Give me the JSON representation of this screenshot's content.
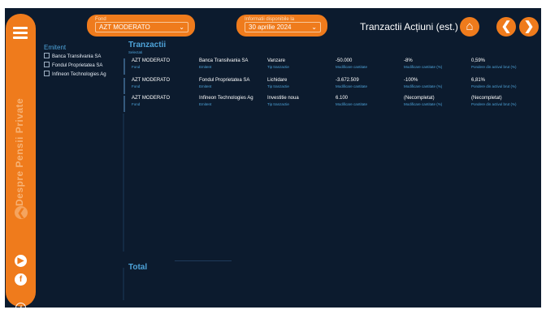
{
  "sidebar": {
    "vertical_text": "Despre Pensii Private"
  },
  "fund_select": {
    "label": "Fond",
    "value": "AZT MODERATO"
  },
  "date_select": {
    "label": "Informatii disponibile la",
    "value": "30 aprilie 2024"
  },
  "header": {
    "title": "Tranzactii Acțiuni (est.)"
  },
  "filter": {
    "title": "Emitent",
    "items": [
      "Banca Transilvania SA",
      "Fondul Proprietatea SA",
      "Infineon Technologies Ag"
    ]
  },
  "main": {
    "title": "Tranzactii",
    "subtitle": "Selectati",
    "total_label": "Total",
    "rows": [
      {
        "fund": "AZT MODERATO",
        "fund_cap": "Fond",
        "issuer": "Banca Transilvania SA",
        "issuer_cap": "Emitent",
        "type": "Vanzare",
        "type_cap": "Tip tranzactie",
        "qty": "-50.000",
        "qty_cap": "Modificare cantitate",
        "pct": "-8%",
        "pct_cap": "Modificare cantitate (%)",
        "weight": "0,59%",
        "weight_cap": "Pondere din activul brut (%)"
      },
      {
        "fund": "AZT MODERATO",
        "fund_cap": "Fond",
        "issuer": "Fondul Proprietatea SA",
        "issuer_cap": "Emitent",
        "type": "Lichidare",
        "type_cap": "Tip tranzactie",
        "qty": "-3.672.509",
        "qty_cap": "Modificare cantitate",
        "pct": "-100%",
        "pct_cap": "Modificare cantitate (%)",
        "weight": "6,81%",
        "weight_cap": "Pondere din activul brut (%)"
      },
      {
        "fund": "AZT MODERATO",
        "fund_cap": "Fond",
        "issuer": "Infineon Technologies Ag",
        "issuer_cap": "Emitent",
        "type": "Investitie noua",
        "type_cap": "Tip tranzactie",
        "qty": "6.100",
        "qty_cap": "Modificare cantitate",
        "pct": "(Necompletat)",
        "pct_cap": "Modificare cantitate (%)",
        "weight": "(Necompletat)",
        "weight_cap": "Pondere din activul brut (%)"
      }
    ]
  },
  "colors": {
    "accent": "#ef7b1c",
    "background": "#0c1b2e",
    "label_blue": "#4ea3d9"
  },
  "icons": [
    "menu-icon",
    "home-icon",
    "chevron-left-icon",
    "chevron-right-icon",
    "back-icon",
    "youtube-icon",
    "facebook-icon",
    "info-icon"
  ]
}
